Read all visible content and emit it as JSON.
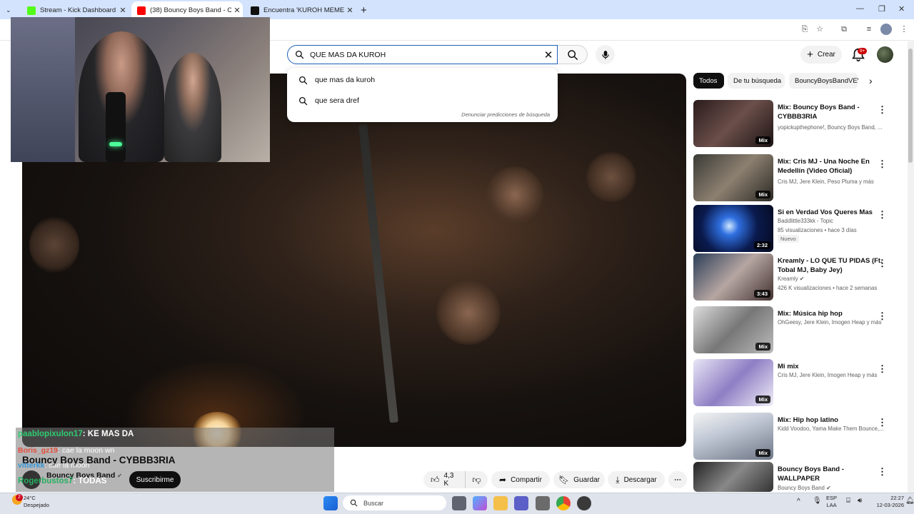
{
  "browser": {
    "tabs": [
      {
        "title": "Stream - Kick Dashboard",
        "favicon_color": "#53fc18"
      },
      {
        "title": "(38) Bouncy Boys Band - CYBB",
        "favicon_color": "#ff0000"
      },
      {
        "title": "Encuentra 'KUROH MEME ' en T",
        "favicon_color": "#111111"
      }
    ],
    "new_tab": "+"
  },
  "youtube": {
    "search_value": "QUE MAS DA KUROH",
    "suggestions": [
      "que mas da kuroh",
      "que sera dref"
    ],
    "report_link": "Denunciar predicciones de búsqueda",
    "create_label": "Crear",
    "notifications_badge": "9+",
    "chips": [
      "Todos",
      "De tu búsqueda",
      "BouncyBoysBandVEVO"
    ],
    "video": {
      "title": "Bouncy Boys Band - CYBBB3RIA",
      "channel": "Bouncy Boys Band",
      "subscribe": "Suscribirme",
      "likes": "4,3 K",
      "share": "Compartir",
      "save": "Guardar",
      "download": "Descargar"
    },
    "recommendations": [
      {
        "title": "Mix: Bouncy Boys Band - CYBBB3RIA",
        "meta1": "yopickupthephone!, Bouncy Boys Band, ...",
        "meta2": "",
        "badge": "Mix",
        "new": ""
      },
      {
        "title": "Mix: Cris MJ - Una Noche En Medellín (Video Oficial)",
        "meta1": "Cris MJ, Jere Klein, Peso Pluma y más",
        "meta2": "",
        "badge": "Mix",
        "new": ""
      },
      {
        "title": "Si en Verdad Vos Queres Mas",
        "meta1": "Baddlittle333kk - Topic",
        "meta2": "85 visualizaciones • hace 3 días",
        "badge": "2:32",
        "new": "Nuevo"
      },
      {
        "title": "Kreamly - LO QUE TU PIDAS (Ft. Tobal MJ, Baby Jey)",
        "meta1": "Kreamly",
        "meta2": "426 K visualizaciones • hace 2 semanas",
        "badge": "3:43",
        "new": ""
      },
      {
        "title": "Mix: Música hip hop",
        "meta1": "OhGeesy, Jere Klein, Imogen Heap y más",
        "meta2": "",
        "badge": "Mix",
        "new": ""
      },
      {
        "title": "Mi mix",
        "meta1": "Cris MJ, Jere Klein, Imogen Heap y más",
        "meta2": "",
        "badge": "Mix",
        "new": ""
      },
      {
        "title": "Mix: Hip hop latino",
        "meta1": "Kidd Voodoo, Yama Make Them Bounce,...",
        "meta2": "",
        "badge": "Mix",
        "new": ""
      },
      {
        "title": "Bouncy Boys Band - WALLPAPER",
        "meta1": "Bouncy Boys Band",
        "meta2": "",
        "badge": "",
        "new": ""
      }
    ]
  },
  "chat": [
    {
      "user": "paablopixulon17",
      "msg": ": KE MAS DA",
      "color": "#2ecc71"
    },
    {
      "user": "Boris_gz19",
      "msg": ": cae la moon wn",
      "color": "#e74c3c"
    },
    {
      "user": "vitterkk",
      "msg": ": cae la moon",
      "color": "#3498db"
    },
    {
      "user": "Rogerbustos7",
      "msg": ": TODAS",
      "color": "#27ae60"
    }
  ],
  "taskbar": {
    "weather_temp": "24°C",
    "weather_desc": "Despejado",
    "weather_badge": "2",
    "search_placeholder": "Buscar",
    "lang1": "ESP",
    "lang2": "LAA",
    "time": "22:27",
    "date": "12-03-2026"
  }
}
